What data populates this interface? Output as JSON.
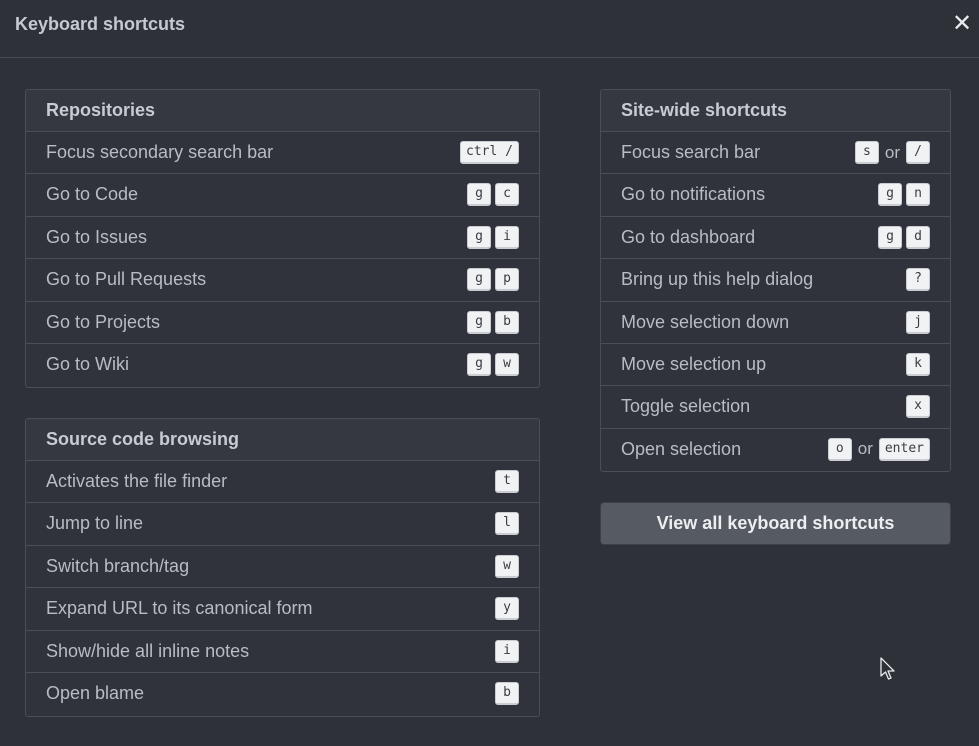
{
  "dialog": {
    "title": "Keyboard shortcuts",
    "close_glyph": "✕"
  },
  "repositories": {
    "heading": "Repositories",
    "rows": [
      {
        "label": "Focus secondary search bar",
        "keys": [
          "ctrl /"
        ]
      },
      {
        "label": "Go to Code",
        "keys": [
          "g",
          "c"
        ]
      },
      {
        "label": "Go to Issues",
        "keys": [
          "g",
          "i"
        ]
      },
      {
        "label": "Go to Pull Requests",
        "keys": [
          "g",
          "p"
        ]
      },
      {
        "label": "Go to Projects",
        "keys": [
          "g",
          "b"
        ]
      },
      {
        "label": "Go to Wiki",
        "keys": [
          "g",
          "w"
        ]
      }
    ]
  },
  "source": {
    "heading": "Source code browsing",
    "rows": [
      {
        "label": "Activates the file finder",
        "keys": [
          "t"
        ]
      },
      {
        "label": "Jump to line",
        "keys": [
          "l"
        ]
      },
      {
        "label": "Switch branch/tag",
        "keys": [
          "w"
        ]
      },
      {
        "label": "Expand URL to its canonical form",
        "keys": [
          "y"
        ]
      },
      {
        "label": "Show/hide all inline notes",
        "keys": [
          "i"
        ]
      },
      {
        "label": "Open blame",
        "keys": [
          "b"
        ]
      }
    ]
  },
  "sitewide": {
    "heading": "Site-wide shortcuts",
    "or_text": "or",
    "rows": [
      {
        "label": "Focus search bar",
        "keys": [
          "s",
          "or",
          "/"
        ]
      },
      {
        "label": "Go to notifications",
        "keys": [
          "g",
          "n"
        ]
      },
      {
        "label": "Go to dashboard",
        "keys": [
          "g",
          "d"
        ]
      },
      {
        "label": "Bring up this help dialog",
        "keys": [
          "?"
        ]
      },
      {
        "label": "Move selection down",
        "keys": [
          "j"
        ]
      },
      {
        "label": "Move selection up",
        "keys": [
          "k"
        ]
      },
      {
        "label": "Toggle selection",
        "keys": [
          "x"
        ]
      },
      {
        "label": "Open selection",
        "keys": [
          "o",
          "or",
          "enter"
        ]
      }
    ]
  },
  "view_all_label": "View all keyboard shortcuts",
  "icons": {
    "close": "close-icon",
    "cursor": "mouse-pointer-icon"
  }
}
